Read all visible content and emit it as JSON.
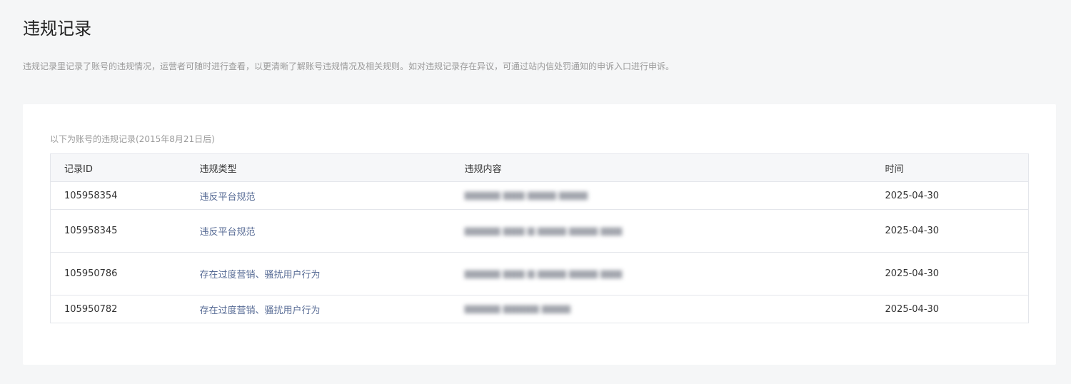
{
  "page": {
    "title": "违规记录",
    "description": "违规记录里记录了账号的违规情况，运营者可随时进行查看，以更清晰了解账号违规情况及相关规则。如对违规记录存在异议，可通过站内信处罚通知的申诉入口进行申诉。"
  },
  "card": {
    "caption": "以下为账号的违规记录(2015年8月21日后)"
  },
  "table": {
    "headers": {
      "id": "记录ID",
      "type": "违规类型",
      "content": "违规内容",
      "time": "时间"
    },
    "rows": [
      {
        "id": "105958354",
        "type": "违反平台规范",
        "content": "▆▆▆▆▆ ▆▆▆ ▆▆▆▆ ▆▆▆▆",
        "time": "2025-04-30"
      },
      {
        "id": "105958345",
        "type": "违反平台规范",
        "content": "▆▆▆▆▆ ▆▆▆ ▆ ▆▆▆▆ ▆▆▆▆ ▆▆▆",
        "time": "2025-04-30"
      },
      {
        "id": "105950786",
        "type": "存在过度营销、骚扰用户行为",
        "content": "▆▆▆▆▆ ▆▆▆ ▆ ▆▆▆▆ ▆▆▆▆ ▆▆▆",
        "time": "2025-04-30"
      },
      {
        "id": "105950782",
        "type": "存在过度营销、骚扰用户行为",
        "content": "▆▆▆▆▆ ▆▆▆▆▆ ▆▆▆▆",
        "time": "2025-04-30"
      }
    ]
  },
  "colors": {
    "background": "#f5f6f7",
    "link": "#576b95",
    "header_bg": "#f6f7f9",
    "border": "#e4e6eb"
  }
}
